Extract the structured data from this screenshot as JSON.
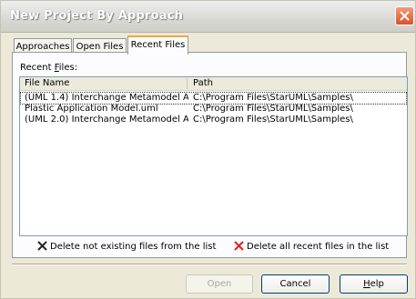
{
  "window": {
    "title": "New Project By Approach"
  },
  "tabs": [
    {
      "label": "Approaches",
      "active": false
    },
    {
      "label": "Open Files",
      "active": false
    },
    {
      "label": "Recent Files",
      "active": true
    }
  ],
  "recent": {
    "label_pre": "Recent ",
    "label_accel": "F",
    "label_post": "iles:",
    "columns": [
      "File Name",
      "Path"
    ],
    "rows": [
      {
        "name": "(UML 1.4) Interchange Metamodel A...",
        "path": "C:\\Program Files\\StarUML\\Samples\\"
      },
      {
        "name": "Plastic Application Model.uml",
        "path": "C:\\Program Files\\StarUML\\Samples\\"
      },
      {
        "name": "(UML 2.0) Interchange Metamodel A...",
        "path": "C:\\Program Files\\StarUML\\Samples\\"
      }
    ]
  },
  "actions": {
    "delete_not_existing": "Delete not existing files from the list",
    "delete_all": "Delete all recent files in the list"
  },
  "buttons": {
    "open": "Open",
    "cancel": "Cancel",
    "help_accel": "H",
    "help_rest": "elp"
  },
  "colors": {
    "delete_not_existing_icon": "#222222",
    "delete_all_icon": "#E02020",
    "active_tab_accent": "#F3A742"
  }
}
